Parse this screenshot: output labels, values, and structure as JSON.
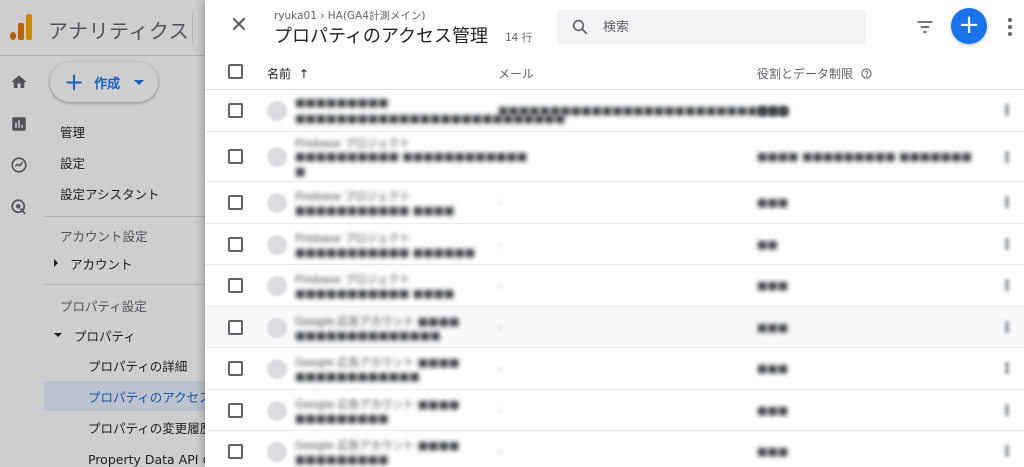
{
  "app": {
    "title": "アナリティクス"
  },
  "sidebar": {
    "create_label": "作成",
    "items": [
      {
        "label": "管理"
      },
      {
        "label": "設定"
      },
      {
        "label": "設定アシスタント"
      }
    ],
    "account_section": "アカウント設定",
    "account_item": "アカウント",
    "property_section": "プロパティ設定",
    "property_item": "プロパティ",
    "property_children": [
      {
        "label": "プロパティの詳細"
      },
      {
        "label": "プロパティのアクセス"
      },
      {
        "label": "プロパティの変更履歴"
      },
      {
        "label": "Property Data API の"
      }
    ]
  },
  "panel": {
    "breadcrumb": "ryuka01 › HA(GA4計測メイン)",
    "title": "プロパティのアクセス管理",
    "row_count": "14 行",
    "search_placeholder": "検索"
  },
  "table": {
    "columns": {
      "name": "名前",
      "sort_arrow": "↑",
      "email": "メール",
      "role": "役割とデータ制限"
    },
    "rows": [
      {
        "name_line1": "■■■■■■■■■",
        "name_line2": "■■■■■■■■■■■■■■■■■■■■■■■■■■",
        "email": "■■■■■■■■■■■■■■■■■■■■■■■■■■■■",
        "role": "■■■"
      },
      {
        "name_line1": "Firebase プロジェクト",
        "name_line2": "■■■■■■■■■■ ■■■■■■■■■■■■",
        "name_line3": "■",
        "email": "-",
        "role": "■■■■ ■■■■■■■■■ ■■■■■■■"
      },
      {
        "name_line1": "Firebase プロジェクト",
        "name_line2": "■■■■■■■■■■■ ■■■■",
        "email": "-",
        "role": "■■■"
      },
      {
        "name_line1": "Firebase プロジェクト",
        "name_line2": "■■■■■■■■■■■ ■■■■■■",
        "email": "-",
        "role": "■■"
      },
      {
        "name_line1": "Firebase プロジェクト",
        "name_line2": "■■■■■■■■■■■ ■■■■",
        "email": "-",
        "role": "■■■"
      },
      {
        "name_line1": "Google 広告アカウント ■■■■",
        "name_line2": "■■■■■■■■■■■■■■",
        "email": "-",
        "role": "■■■"
      },
      {
        "name_line1": "Google 広告アカウント ■■■■",
        "name_line2": "■■■■■■■■■■■■",
        "email": "-",
        "role": "■■■"
      },
      {
        "name_line1": "Google 広告アカウント ■■■■",
        "name_line2": "■■■■■■■■■",
        "email": "-",
        "role": "■■■"
      },
      {
        "name_line1": "Google 広告アカウント ■■■■",
        "name_line2": "■■■■■■■■■",
        "email": "-",
        "role": "■■■"
      }
    ]
  },
  "colors": {
    "accent": "#1a73e8",
    "text": "#202124",
    "muted": "#5f6368"
  }
}
